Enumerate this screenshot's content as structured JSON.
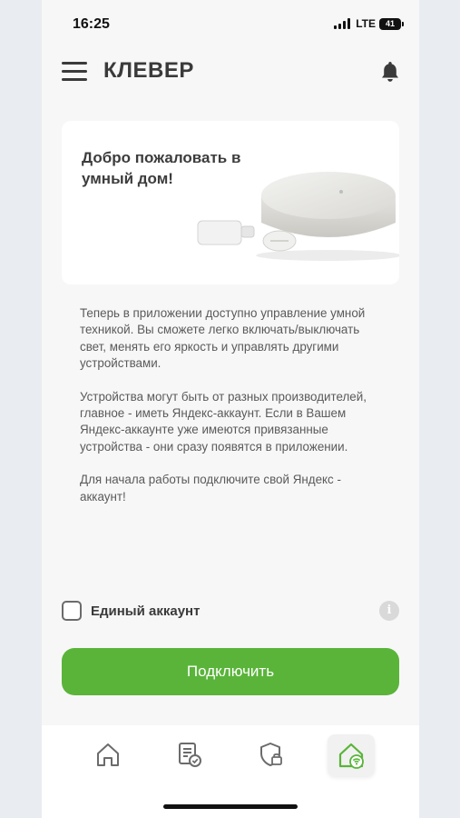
{
  "status_bar": {
    "time": "16:25",
    "network": "LTE",
    "battery": "41"
  },
  "header": {
    "title": "КЛЕВЕР"
  },
  "banner": {
    "title": "Добро пожаловать в умный дом!"
  },
  "description": {
    "paragraphs": [
      "Теперь в приложении доступно управление умной техникой. Вы сможете легко включать/выключать свет, менять его яркость и управлять другими устройствами.",
      "Устройства могут быть от разных производителей, главное - иметь Яндекс-аккаунт. Если в Вашем Яндекс-аккаунте уже имеются привязанные устройства - они сразу появятся в приложении.",
      "Для начала работы подключите свой Яндекс - аккаунт!"
    ]
  },
  "account": {
    "checkbox_label": "Единый аккаунт",
    "checked": false,
    "info_glyph": "i"
  },
  "connect_button": {
    "label": "Подключить"
  },
  "bottom_nav": {
    "items": [
      {
        "icon": "home-icon",
        "active": false
      },
      {
        "icon": "document-check-icon",
        "active": false
      },
      {
        "icon": "shield-lock-icon",
        "active": false
      },
      {
        "icon": "smart-home-wifi-icon",
        "active": true
      }
    ]
  },
  "colors": {
    "accent_green": "#5ab43a",
    "title_gray": "#3a3a3a",
    "text_gray": "#5a5a5a"
  }
}
